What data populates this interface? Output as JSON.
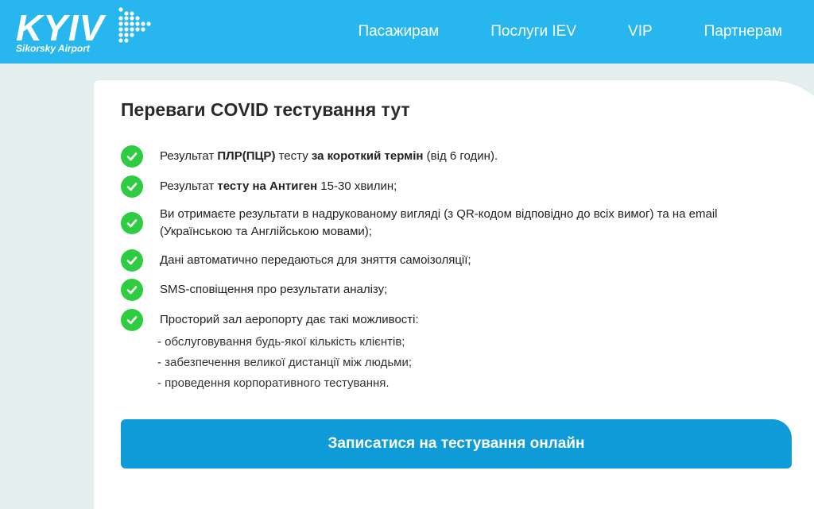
{
  "header": {
    "logo_text": "KYIV",
    "logo_subtitle": "Sikorsky Airport",
    "nav": [
      "Пасажирам",
      "Послуги IEV",
      "VIP",
      "Партнерам"
    ]
  },
  "card": {
    "title": "Переваги COVID тестування тут",
    "items": [
      {
        "parts": [
          {
            "t": "Результат ",
            "b": false
          },
          {
            "t": "ПЛР(ПЦР)",
            "b": true
          },
          {
            "t": " тесту ",
            "b": false
          },
          {
            "t": "за короткий термін",
            "b": true
          },
          {
            "t": " (від 6 годин).",
            "b": false
          }
        ]
      },
      {
        "parts": [
          {
            "t": "Результат ",
            "b": false
          },
          {
            "t": "тесту на Антиген",
            "b": true
          },
          {
            "t": " 15-30 хвилин;",
            "b": false
          }
        ]
      },
      {
        "parts": [
          {
            "t": "Ви отримаєте результати в надрукованому вигляді (з QR-кодом відповідно до всіх вимог) та на email (Українською та Англійською мовами);",
            "b": false
          }
        ]
      },
      {
        "parts": [
          {
            "t": "Дані автоматично передаються для зняття самоізоляції;",
            "b": false
          }
        ]
      },
      {
        "parts": [
          {
            "t": "SMS-сповіщення про результати аналізу;",
            "b": false
          }
        ]
      },
      {
        "parts": [
          {
            "t": "Просторий зал аеропорту дає такі можливості:",
            "b": false
          }
        ]
      }
    ],
    "sub_items": [
      "- обслуговування будь-якої кількість клієнтів;",
      "- забезпечення великої дистанції між людьми;",
      "- проведення корпоративного тестування."
    ]
  },
  "cta": {
    "label": "Записатися на тестування онлайн"
  },
  "colors": {
    "header_bg": "#27b6ee",
    "check_green": "#2ecc40",
    "cta_bg": "#0e9bd8"
  }
}
